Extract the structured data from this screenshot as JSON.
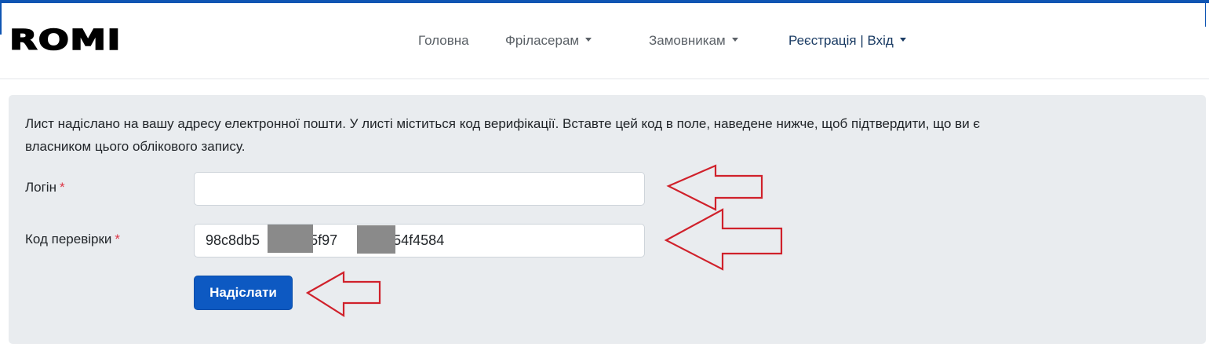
{
  "header": {
    "logo": "ROMI",
    "nav": {
      "home": "Головна",
      "freelancers": "Фріласерам",
      "clients": "Замовникам",
      "register_login": "Реєстрація | Вхід"
    }
  },
  "form": {
    "intro_line1": "Лист надіслано на вашу адресу електронної пошти. У листі міститься код верифікації. Вставте цей код в поле, наведене нижче, щоб підтвердити, що ви є",
    "intro_line2": "власником цього облікового запису.",
    "login_label": "Логін",
    "login_value": "",
    "code_label": "Код перевірки",
    "code_value": "98c8db5   65f97  f60454f4584",
    "required_mark": "*",
    "submit_label": "Надіслати"
  },
  "colors": {
    "accent": "#0d59c2",
    "panel_bg": "#e9ecef",
    "annotation_arrow": "#d0212b",
    "required": "#dc3545"
  }
}
